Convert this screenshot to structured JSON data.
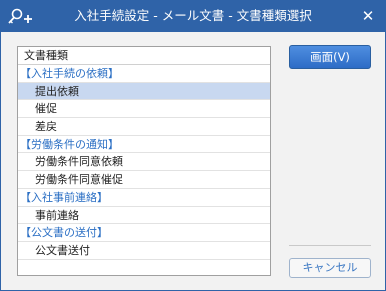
{
  "window": {
    "title": "入社手続設定 - メール文書 - 文書種類選択",
    "close_icon": "close-icon",
    "app_icon": "key-plus-icon"
  },
  "list": {
    "header": "文書種類",
    "rows": [
      {
        "type": "group",
        "label": "【入社手続の依頼】"
      },
      {
        "type": "item",
        "label": "提出依頼",
        "selected": true
      },
      {
        "type": "item",
        "label": "催促"
      },
      {
        "type": "item",
        "label": "差戻"
      },
      {
        "type": "group",
        "label": "【労働条件の通知】"
      },
      {
        "type": "item",
        "label": "労働条件同意依頼"
      },
      {
        "type": "item",
        "label": "労働条件同意催促"
      },
      {
        "type": "group",
        "label": "【入社事前連絡】"
      },
      {
        "type": "item",
        "label": "事前連絡"
      },
      {
        "type": "group",
        "label": "【公文書の送付】"
      },
      {
        "type": "item",
        "label": "公文書送付"
      },
      {
        "type": "empty",
        "label": ""
      }
    ]
  },
  "buttons": {
    "view": "画面(V)",
    "cancel": "キャンセル"
  },
  "colors": {
    "titlebar": "#2f63a8",
    "group_text": "#2b6fc4",
    "selected_row": "#c8d8f0",
    "primary_button": "#2d6cc6"
  }
}
